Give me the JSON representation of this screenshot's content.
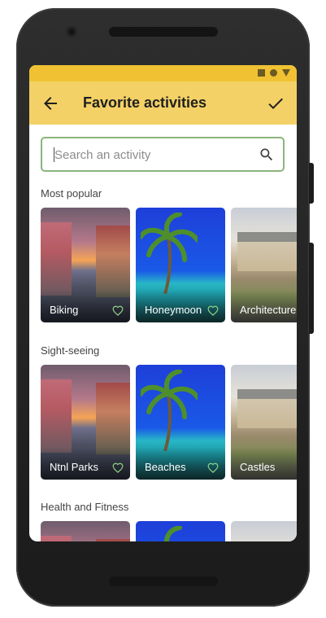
{
  "app_bar": {
    "title": "Favorite activities"
  },
  "search": {
    "placeholder": "Search an activity"
  },
  "sections": [
    {
      "title": "Most popular",
      "cards": [
        {
          "label": "Biking",
          "image": "canal",
          "favorite_icon": "heart-outline-icon"
        },
        {
          "label": "Honeymoon",
          "image": "beach",
          "favorite_icon": "heart-outline-icon"
        },
        {
          "label": "Architecture",
          "image": "house"
        }
      ]
    },
    {
      "title": "Sight-seeing",
      "cards": [
        {
          "label": "Ntnl Parks",
          "image": "canal",
          "favorite_icon": "heart-outline-icon"
        },
        {
          "label": "Beaches",
          "image": "beach",
          "favorite_icon": "heart-outline-icon"
        },
        {
          "label": "Castles",
          "image": "house"
        }
      ]
    },
    {
      "title": "Health and Fitness",
      "cards": [
        {
          "label": "",
          "image": "canal"
        },
        {
          "label": "",
          "image": "beach"
        },
        {
          "label": "",
          "image": "house"
        }
      ]
    }
  ],
  "colors": {
    "status_bar": "#f0c233",
    "app_bar": "#f4d166",
    "search_border": "#8bb47d",
    "heart": "#8fd48a"
  }
}
